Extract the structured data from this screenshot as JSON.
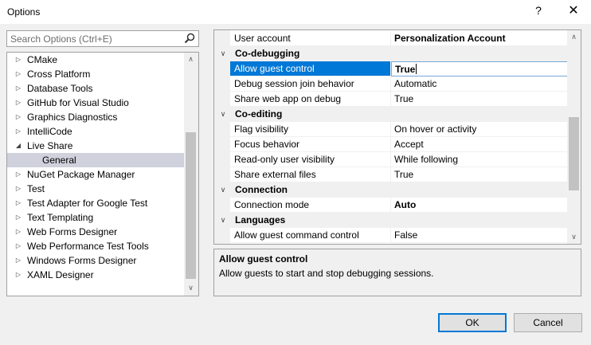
{
  "window": {
    "title": "Options",
    "help": "?",
    "close": "✕"
  },
  "search": {
    "placeholder": "Search Options (Ctrl+E)"
  },
  "tree": {
    "items": [
      {
        "label": "CMake",
        "expanded": false
      },
      {
        "label": "Cross Platform",
        "expanded": false
      },
      {
        "label": "Database Tools",
        "expanded": false
      },
      {
        "label": "GitHub for Visual Studio",
        "expanded": false
      },
      {
        "label": "Graphics Diagnostics",
        "expanded": false
      },
      {
        "label": "IntelliCode",
        "expanded": false
      },
      {
        "label": "Live Share",
        "expanded": true
      },
      {
        "label": "General",
        "child": true,
        "selected": true
      },
      {
        "label": "NuGet Package Manager",
        "expanded": false
      },
      {
        "label": "Test",
        "expanded": false
      },
      {
        "label": "Test Adapter for Google Test",
        "expanded": false
      },
      {
        "label": "Text Templating",
        "expanded": false
      },
      {
        "label": "Web Forms Designer",
        "expanded": false
      },
      {
        "label": "Web Performance Test Tools",
        "expanded": false
      },
      {
        "label": "Windows Forms Designer",
        "expanded": false
      },
      {
        "label": "XAML Designer",
        "expanded": false
      }
    ]
  },
  "grid": {
    "rows": [
      {
        "type": "prop",
        "name": "User account",
        "value": "Personalization Account",
        "bold": true
      },
      {
        "type": "cat",
        "name": "Co-debugging"
      },
      {
        "type": "prop",
        "name": "Allow guest control",
        "value": "True",
        "selected": true
      },
      {
        "type": "prop",
        "name": "Debug session join behavior",
        "value": "Automatic"
      },
      {
        "type": "prop",
        "name": "Share web app on debug",
        "value": "True"
      },
      {
        "type": "cat",
        "name": "Co-editing"
      },
      {
        "type": "prop",
        "name": "Flag visibility",
        "value": "On hover or activity"
      },
      {
        "type": "prop",
        "name": "Focus behavior",
        "value": "Accept"
      },
      {
        "type": "prop",
        "name": "Read-only user visibility",
        "value": "While following"
      },
      {
        "type": "prop",
        "name": "Share external files",
        "value": "True"
      },
      {
        "type": "cat",
        "name": "Connection"
      },
      {
        "type": "prop",
        "name": "Connection mode",
        "value": "Auto",
        "bold": true
      },
      {
        "type": "cat",
        "name": "Languages"
      },
      {
        "type": "prop",
        "name": "Allow guest command control",
        "value": "False"
      }
    ]
  },
  "description": {
    "title": "Allow guest control",
    "text": "Allow guests to start and stop debugging sessions."
  },
  "buttons": {
    "ok": "OK",
    "cancel": "Cancel"
  },
  "icons": {
    "search": "search-icon",
    "expand": "▷",
    "collapse": "◢",
    "category_expanded": "∨",
    "scroll_up": "∧",
    "scroll_down": "∨",
    "dropdown": "∨"
  },
  "colors": {
    "selection": "#0078d7",
    "tree_selection": "#cfd1dc"
  }
}
